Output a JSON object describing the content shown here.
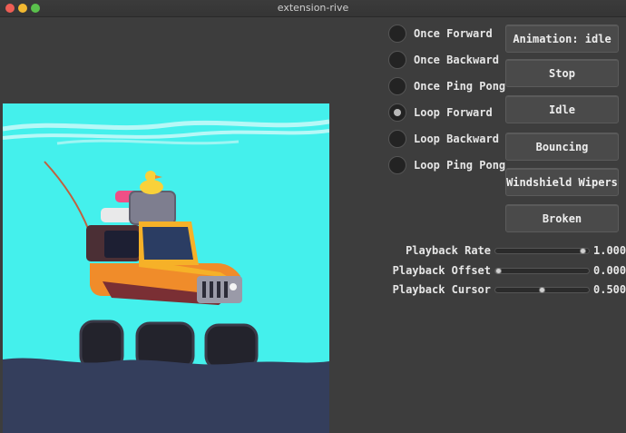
{
  "window": {
    "title": "extension-rive"
  },
  "playback_modes": [
    {
      "label": "Once Forward",
      "selected": false
    },
    {
      "label": "Once Backward",
      "selected": false
    },
    {
      "label": "Once Ping Pong",
      "selected": false
    },
    {
      "label": "Loop Forward",
      "selected": true
    },
    {
      "label": "Loop Backward",
      "selected": false
    },
    {
      "label": "Loop Ping Pong",
      "selected": false
    }
  ],
  "buttons": {
    "animation_idle": "Animation: idle",
    "stop": "Stop",
    "idle": "Idle",
    "bouncing": "Bouncing",
    "windshield_wipers": "Windshield Wipers",
    "broken": "Broken"
  },
  "sliders": {
    "playback_rate": {
      "label": "Playback Rate",
      "value": "1.000",
      "fraction": 0.97
    },
    "playback_offset": {
      "label": "Playback Offset",
      "value": "0.000",
      "fraction": 0.0
    },
    "playback_cursor": {
      "label": "Playback Cursor",
      "value": "0.500",
      "fraction": 0.5
    }
  },
  "colors": {
    "sky": "#44f0ec",
    "ground": "#343e5c",
    "jeep_body": "#f08c2a",
    "jeep_roof": "#f6b128",
    "duck": "#f9d13a"
  }
}
